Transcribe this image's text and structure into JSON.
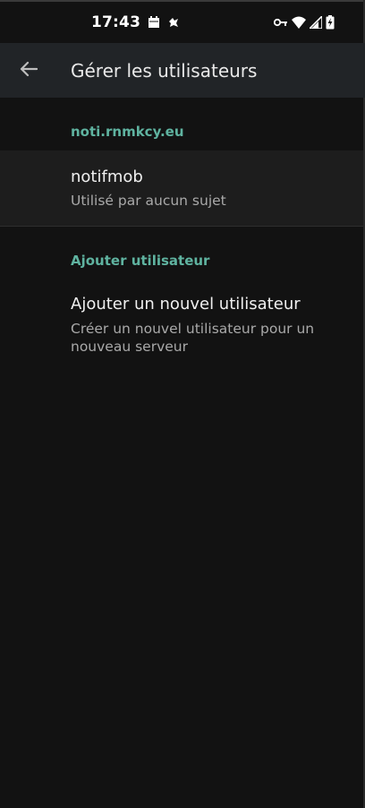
{
  "status_bar": {
    "time": "17:43",
    "left_icons": [
      "calendar-icon",
      "bird-icon"
    ],
    "right_icons": [
      "vpn-key-icon",
      "wifi-icon",
      "signal-icon",
      "battery-charging-icon"
    ]
  },
  "app_bar": {
    "back_icon": "arrow-back-icon",
    "title": "Gérer les utilisateurs"
  },
  "sections": [
    {
      "header": "noti.rnmkcy.eu",
      "items": [
        {
          "title": "notifmob",
          "subtitle": "Utilisé par aucun sujet"
        }
      ]
    },
    {
      "header": "Ajouter utilisateur",
      "items": [
        {
          "title": "Ajouter un nouvel utilisateur",
          "subtitle": "Créer un nouvel utilisateur pour un nouveau serveur"
        }
      ]
    }
  ],
  "colors": {
    "background": "#121212",
    "app_bar": "#212427",
    "accent": "#5fb3a0",
    "highlighted_row": "#1d1d1d"
  }
}
